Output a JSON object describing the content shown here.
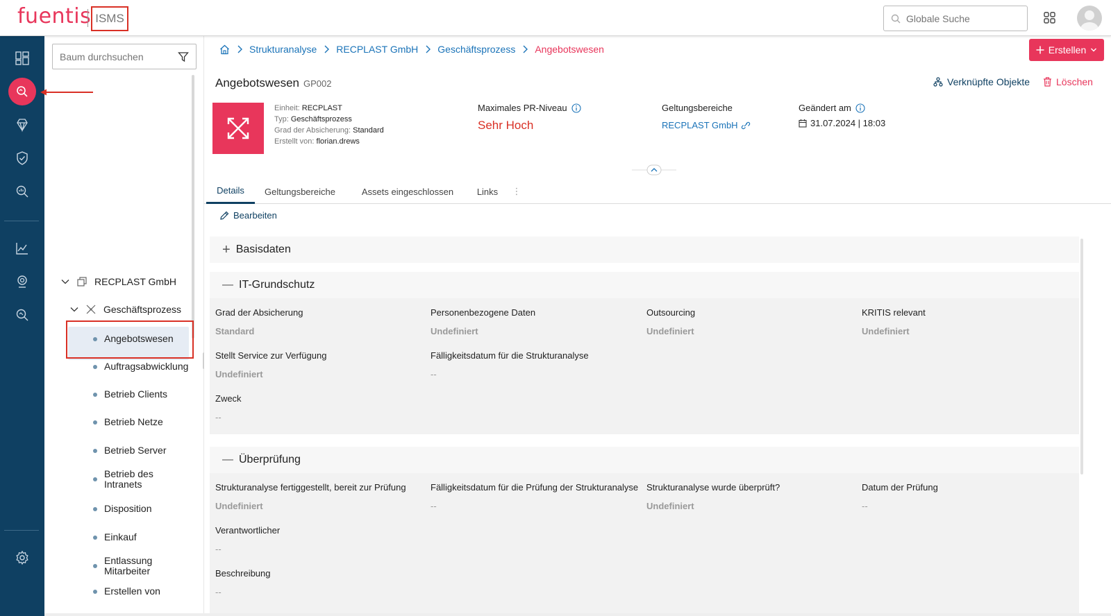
{
  "header": {
    "logo_text": "fuentis",
    "product": "ISMS",
    "search_placeholder": "Globale Suche",
    "brand_color": "#e8365b"
  },
  "rail": {
    "icons": [
      "dashboard-icon",
      "search-analysis-icon",
      "diamond-icon",
      "shield-check-icon",
      "analysis-icon",
      "chart-icon",
      "audit-icon",
      "search-doc-icon",
      "settings-icon"
    ],
    "active": "search-analysis-icon"
  },
  "tree": {
    "search_placeholder": "Baum durchsuchen",
    "root": "RECPLAST GmbH",
    "group": "Geschäftsprozess",
    "items": [
      "Angebotswesen",
      "Auftragsabwicklung",
      "Betrieb Clients",
      "Betrieb Netze",
      "Betrieb Server",
      "Betrieb des Intranets",
      "Disposition",
      "Einkauf",
      "Entlassung Mitarbeiter",
      "Erstellen von"
    ],
    "selected": "Angebotswesen"
  },
  "breadcrumb": [
    "Strukturanalyse",
    "RECPLAST GmbH",
    "Geschäftsprozess",
    "Angebotswesen"
  ],
  "actions": {
    "create_label": "Erstellen",
    "linked_label": "Verknüpfte Objekte",
    "delete_label": "Löschen"
  },
  "object": {
    "title": "Angebotswesen",
    "code": "GP002",
    "meta": {
      "unit_label": "Einheit:",
      "unit": "RECPLAST",
      "type_label": "Typ:",
      "type": "Geschäftsprozess",
      "level_label": "Grad der Absicherung:",
      "level": "Standard",
      "creator_label": "Erstellt von:",
      "creator": "florian.drews"
    },
    "pr_label": "Maximales PR-Niveau",
    "pr_value": "Sehr Hoch",
    "scope_label": "Geltungsbereiche",
    "scope_value": "RECPLAST GmbH",
    "changed_label": "Geändert am",
    "changed_value": "31.07.2024 | 18:03"
  },
  "tabs": [
    "Details",
    "Geltungsbereiche",
    "Assets eingeschlossen",
    "Links"
  ],
  "active_tab": "Details",
  "edit_label": "Bearbeiten",
  "sections": {
    "basis": {
      "title": "Basisdaten",
      "toggle": "+"
    },
    "itg": {
      "title": "IT-Grundschutz",
      "toggle": "—",
      "fields": [
        {
          "label": "Grad der Absicherung",
          "value": "Standard"
        },
        {
          "label": "Personenbezogene Daten",
          "value": "Undefiniert"
        },
        {
          "label": "Outsourcing",
          "value": "Undefiniert"
        },
        {
          "label": "KRITIS relevant",
          "value": "Undefiniert"
        },
        {
          "label": "Stellt Service zur Verfügung",
          "value": "Undefiniert"
        },
        {
          "label": "Fälligkeitsdatum für die Strukturanalyse",
          "value": "--"
        },
        {
          "label": "Zweck",
          "value": "--"
        }
      ]
    },
    "review": {
      "title": "Überprüfung",
      "toggle": "—",
      "fields": [
        {
          "label": "Strukturanalyse fertiggestellt, bereit zur Prüfung",
          "value": "Undefiniert"
        },
        {
          "label": "Fälligkeitsdatum für die Prüfung der Strukturanalyse",
          "value": "--"
        },
        {
          "label": "Strukturanalyse wurde überprüft?",
          "value": "Undefiniert"
        },
        {
          "label": "Datum der Prüfung",
          "value": "--"
        },
        {
          "label": "Verantwortlicher",
          "value": "--"
        },
        {
          "label": "Beschreibung",
          "value": "--"
        }
      ]
    }
  }
}
